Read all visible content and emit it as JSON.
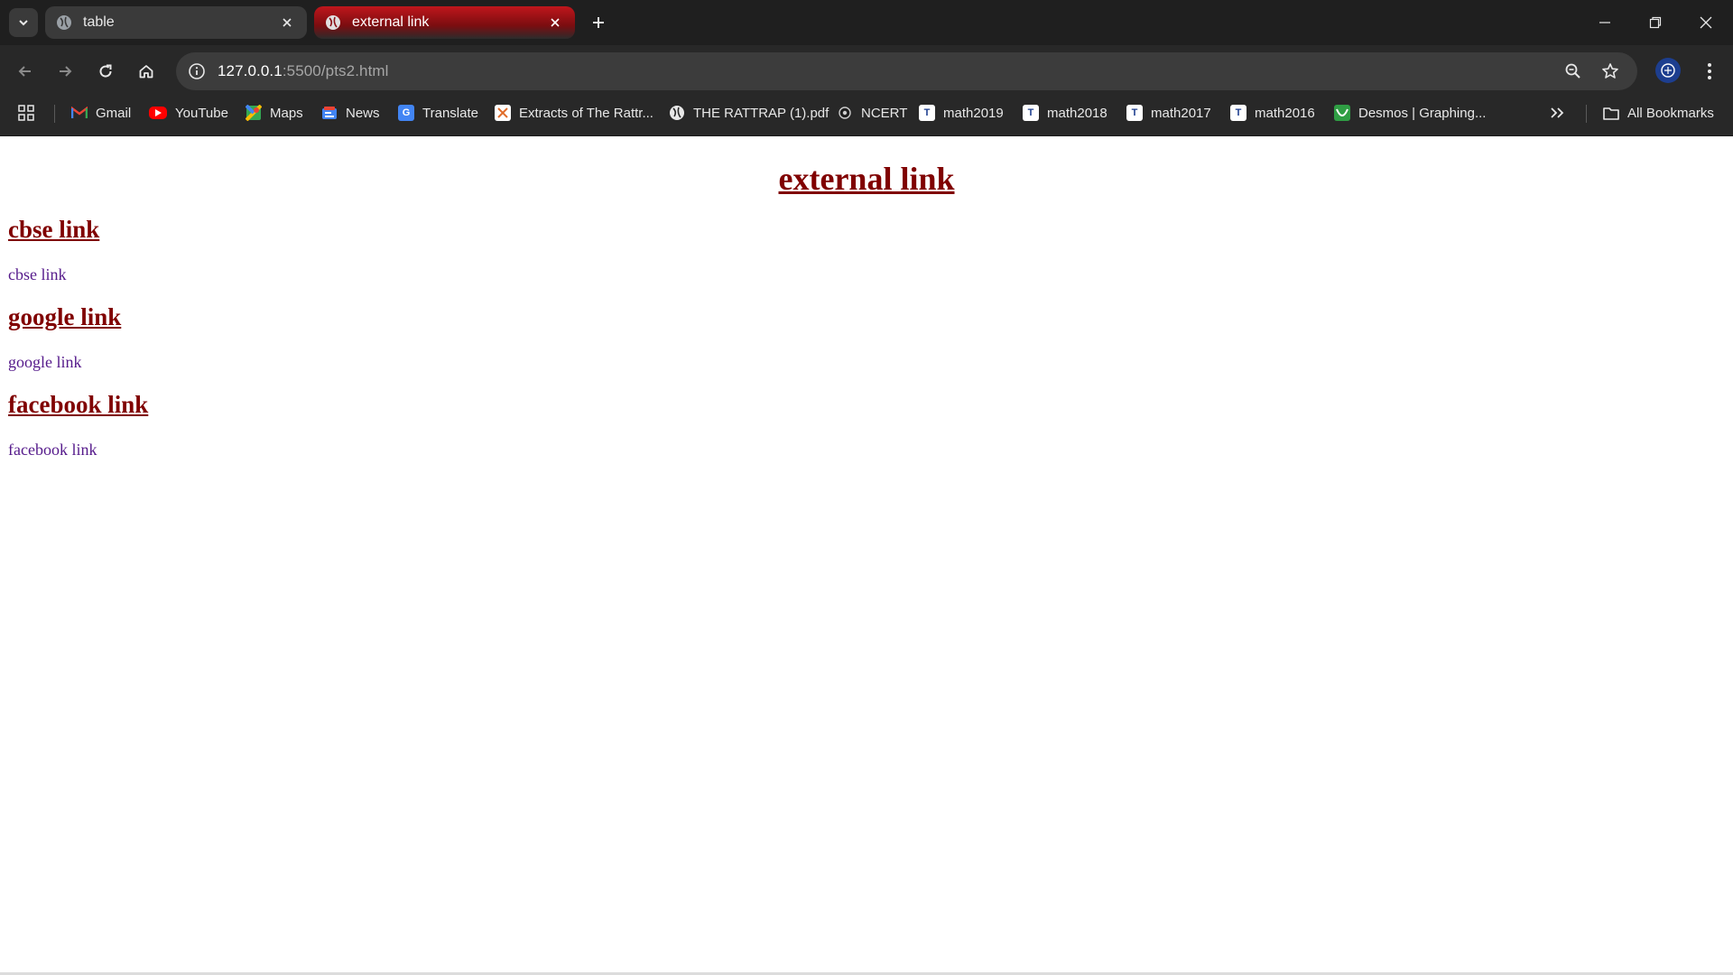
{
  "browser": {
    "tabs": [
      {
        "title": "table",
        "active": false
      },
      {
        "title": "external link",
        "active": true
      }
    ],
    "url_host": "127.0.0.1",
    "url_path": ":5500/pts2.html",
    "accent_color": "#c0161c"
  },
  "bookmarks": {
    "items": [
      {
        "label": "Gmail",
        "icon": "gmail-icon"
      },
      {
        "label": "YouTube",
        "icon": "youtube-icon"
      },
      {
        "label": "Maps",
        "icon": "maps-icon"
      },
      {
        "label": "News",
        "icon": "news-icon"
      },
      {
        "label": "Translate",
        "icon": "translate-icon"
      },
      {
        "label": "Extracts of The Rattr...",
        "icon": "document-icon"
      },
      {
        "label": "THE RATTRAP (1).pdf",
        "icon": "globe-icon"
      },
      {
        "label": "NCERT",
        "icon": "ncert-icon"
      },
      {
        "label": "math2019",
        "icon": "bookmark-page-icon"
      },
      {
        "label": "math2018",
        "icon": "bookmark-page-icon"
      },
      {
        "label": "math2017",
        "icon": "bookmark-page-icon"
      },
      {
        "label": "math2016",
        "icon": "bookmark-page-icon"
      },
      {
        "label": "Desmos | Graphing...",
        "icon": "desmos-icon"
      }
    ],
    "all_bookmarks_label": "All Bookmarks"
  },
  "page": {
    "title": "external link",
    "sections": [
      {
        "heading": "cbse link",
        "text": "cbse link"
      },
      {
        "heading": "google link",
        "text": "google link"
      },
      {
        "heading": "facebook link",
        "text": "facebook link"
      }
    ],
    "heading_color": "#800000",
    "visited_link_color": "#551a8b"
  }
}
